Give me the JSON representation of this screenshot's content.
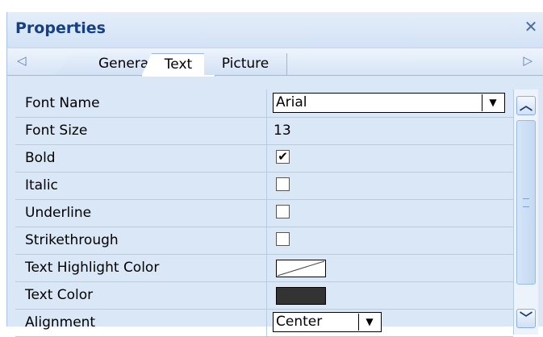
{
  "panel": {
    "title": "Properties",
    "close_glyph": "✕",
    "tabs": [
      {
        "label": "General",
        "active": false
      },
      {
        "label": "Text",
        "active": true
      },
      {
        "label": "Picture",
        "active": false
      }
    ],
    "tab_scroll_left_glyph": "◁",
    "tab_scroll_right_glyph": "▷"
  },
  "properties": [
    {
      "name": "Font Name",
      "type": "combo",
      "value": "Arial"
    },
    {
      "name": "Font Size",
      "type": "text",
      "value": "13"
    },
    {
      "name": "Bold",
      "type": "checkbox",
      "checked": true
    },
    {
      "name": "Italic",
      "type": "checkbox",
      "checked": false
    },
    {
      "name": "Underline",
      "type": "checkbox",
      "checked": false
    },
    {
      "name": "Strikethrough",
      "type": "checkbox",
      "checked": false
    },
    {
      "name": "Text Highlight Color",
      "type": "color",
      "value": "none"
    },
    {
      "name": "Text Color",
      "type": "color",
      "value": "#333333"
    },
    {
      "name": "Alignment",
      "type": "combo",
      "value": "Center"
    }
  ],
  "icons": {
    "close": "close-icon",
    "dropdown": "chevron-down-icon",
    "scroll_up": "chevron-up-icon",
    "scroll_down": "chevron-down-icon"
  },
  "colors": {
    "title": "#153f86",
    "panel_bg": "#d9e7f7",
    "grid_line": "#b7cbe6"
  }
}
